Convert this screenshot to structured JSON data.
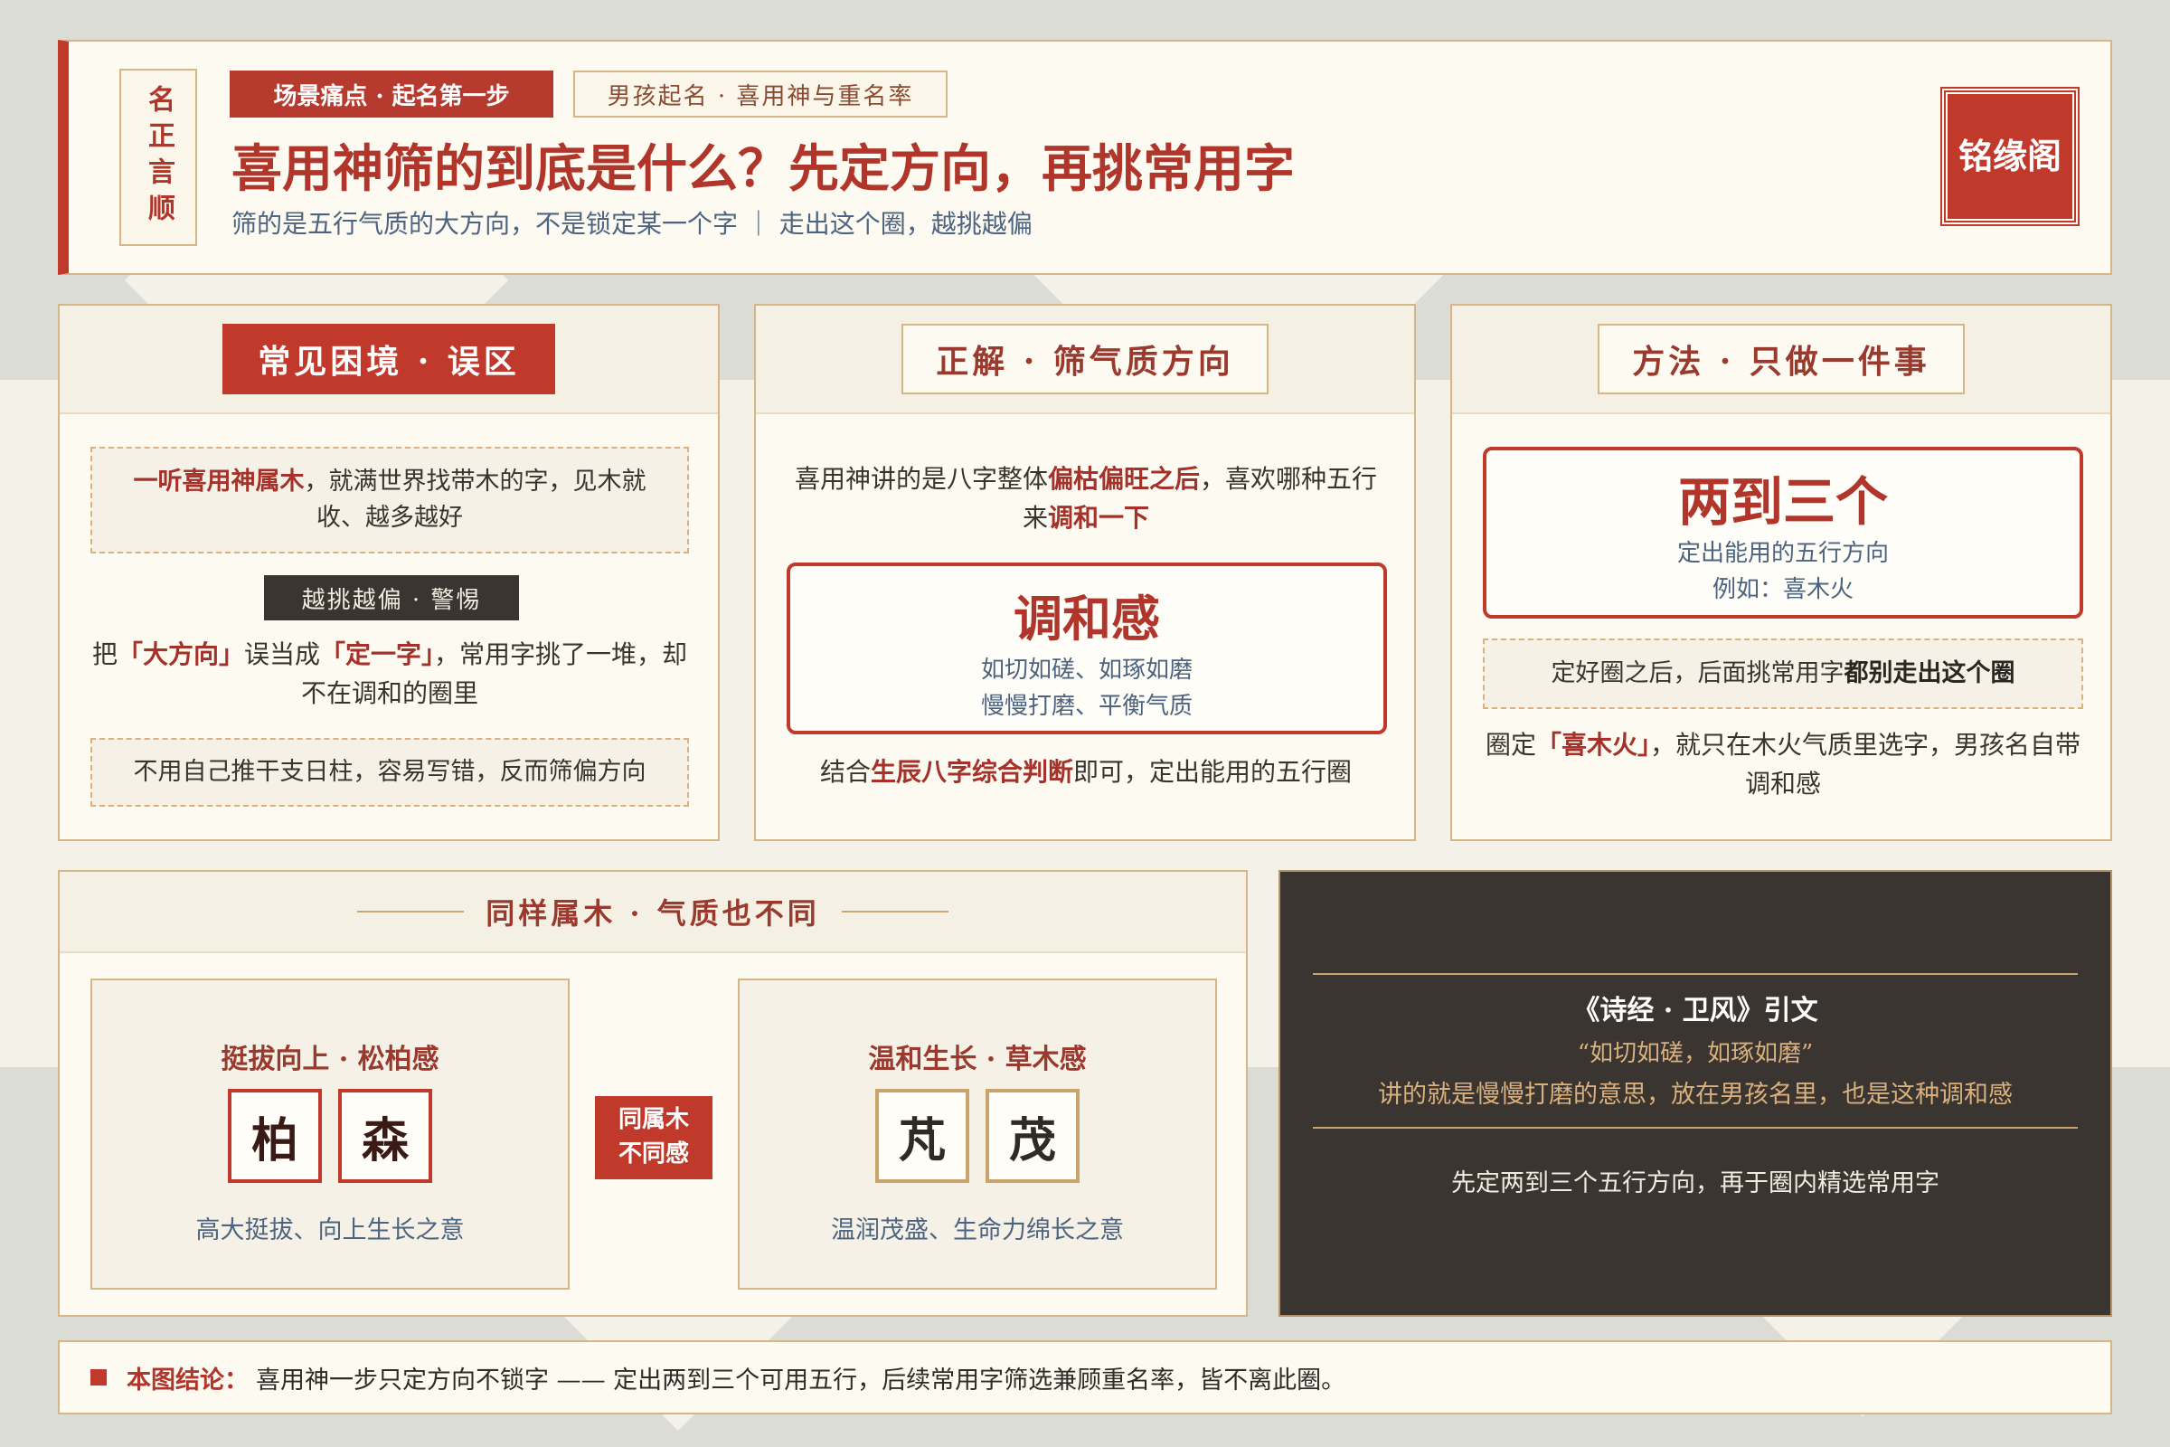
{
  "header": {
    "seal": "名正言顺",
    "tag_primary": "场景痛点 · 起名第一步",
    "tag_secondary": "男孩起名 · 喜用神与重名率",
    "title": "喜用神筛的到底是什么？先定方向，再挑常用字",
    "subtitle": "筛的是五行气质的大方向，不是锁定某一个字 ｜ 走出这个圈，越挑越偏",
    "brand": "铭缘阁"
  },
  "card_misread": {
    "heading": "常见困境 · 误区",
    "box1_hl": "一听喜用神属木",
    "box1_rest": "，就满世界找带木的字，见木就收、越多越好",
    "badge": "越挑越偏 · 警惕",
    "text_a": "把",
    "text_hl1": "「大方向」",
    "text_b": "误当成",
    "text_hl2": "「定一字」",
    "text_c": "，常用字挑了一堆，却不在调和的圈里",
    "box2": "不用自己推干支日柱，容易写错，反而筛偏方向"
  },
  "card_correct": {
    "heading": "正解 · 筛气质方向",
    "intro_a": "喜用神讲的是八字整体",
    "intro_hl": "偏枯偏旺之后",
    "intro_b": "，喜欢哪种五行来",
    "intro_hl2": "调和一下",
    "focus": "调和感",
    "focus_d1": "如切如磋、如琢如磨",
    "focus_d2": "慢慢打磨、平衡气质",
    "outro_a": "结合",
    "outro_hl": "生辰八字综合判断",
    "outro_b": "即可，定出能用的五行圈"
  },
  "card_method": {
    "heading": "方法 · 只做一件事",
    "focus": "两到三个",
    "focus_d1": "定出能用的五行方向",
    "focus_d2": "例如：喜木火",
    "box_a": "定好圈之后，后面挑常用字",
    "box_b": "都别走出这个圈",
    "text_a": "圈定",
    "text_hl": "「喜木火」",
    "text_b": "，就只在木火气质里选字，男孩名自带调和感"
  },
  "wood": {
    "heading": "同样属木 · 气质也不同",
    "left_title": "挺拔向上 · 松柏感",
    "left_chars": [
      "柏",
      "森"
    ],
    "left_desc": "高大挺拔、向上生长之意",
    "middle_badge_1": "同属木",
    "middle_badge_2": "不同感",
    "right_title": "温和生长 · 草木感",
    "right_chars": [
      "芃",
      "茂"
    ],
    "right_desc": "温润茂盛、生命力绵长之意"
  },
  "quote": {
    "title": "《诗经 · 卫风》引文",
    "cite": "“如切如磋，如琢如磨”",
    "explain": "讲的就是慢慢打磨的意思，放在男孩名里，也是这种调和感",
    "footer": "先定两到三个五行方向，再于圈内精选常用字"
  },
  "conclusion": {
    "label": "本图结论：",
    "text": "喜用神一步只定方向不锁字 —— 定出两到三个可用五行，后续常用字筛选兼顾重名率，皆不离此圈。"
  },
  "colors": {
    "accent_red": "#c0392b",
    "gold_border": "#d6b587",
    "dark_panel": "#3a3531",
    "paper": "#fdfaf1",
    "slate_blue": "#4d6480"
  }
}
